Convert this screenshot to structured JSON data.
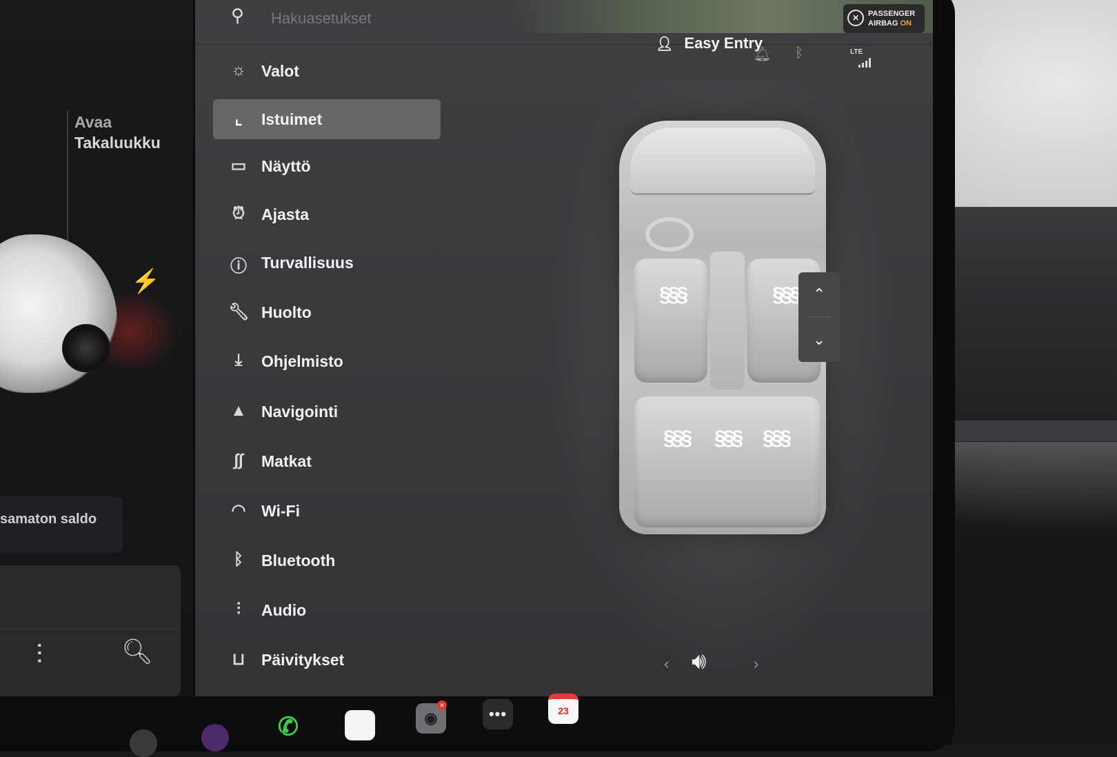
{
  "search": {
    "placeholder": "Hakuasetukset",
    "icon": "search-icon"
  },
  "left_panel": {
    "trunk_line1": "Avaa",
    "trunk_line2": "Takaluukku",
    "balance_text": "samaton saldo",
    "charge_icon": "lightning-icon",
    "quick_icons": [
      "equalizer-icon",
      "search-icon"
    ]
  },
  "status": {
    "profile_name": "Easy Entry",
    "airbag_line1": "PASSENGER",
    "airbag_line2": "AIRBAG",
    "airbag_state": "ON",
    "network": "LTE",
    "icons": [
      "profile-icon",
      "bell-icon",
      "bluetooth-icon",
      "signal-icon"
    ]
  },
  "menu": {
    "selected": "Istuimet",
    "items": [
      {
        "label": "Valot",
        "icon": "sun-icon"
      },
      {
        "label": "Istuimet",
        "icon": "seat-icon"
      },
      {
        "label": "Näyttö",
        "icon": "display-icon"
      },
      {
        "label": "Ajasta",
        "icon": "alarm-clock-icon"
      },
      {
        "label": "Turvallisuus",
        "icon": "alert-circle-icon"
      },
      {
        "label": "Huolto",
        "icon": "wrench-icon"
      },
      {
        "label": "Ohjelmisto",
        "icon": "download-icon"
      },
      {
        "label": "Navigointi",
        "icon": "navigation-arrow-icon"
      },
      {
        "label": "Matkat",
        "icon": "trips-icon"
      },
      {
        "label": "Wi-Fi",
        "icon": "wifi-icon"
      },
      {
        "label": "Bluetooth",
        "icon": "bluetooth-icon"
      },
      {
        "label": "Audio",
        "icon": "equalizer-icon"
      },
      {
        "label": "Päivitykset",
        "icon": "bag-icon"
      }
    ]
  },
  "seats": {
    "heaters": [
      "front-left",
      "front-right",
      "rear-left",
      "rear-center",
      "rear-right"
    ],
    "heater_icon": "seat-heater-icon",
    "scroll_up_icon": "chevron-up-icon",
    "scroll_down_icon": "chevron-down-icon"
  },
  "taskbar": {
    "calendar_day": "23",
    "apps": [
      "phone-icon",
      "blank-app-icon",
      "camera-icon",
      "more-icon",
      "calendar-icon"
    ]
  },
  "colors": {
    "accent_on": "#f0a030",
    "phone_green": "#3fcf4a",
    "badge_red": "#e0392c",
    "selected_bg": "#666669"
  }
}
